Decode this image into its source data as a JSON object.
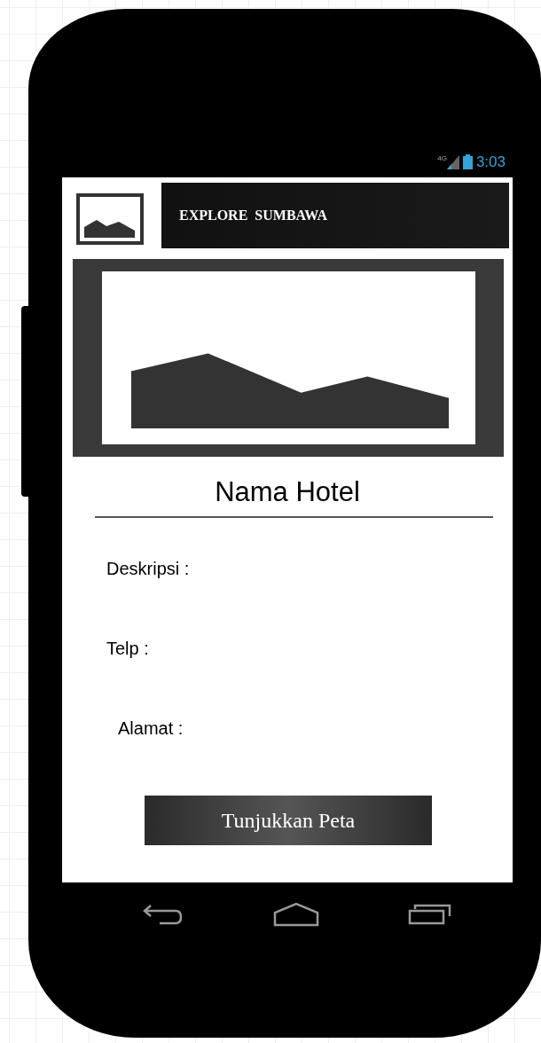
{
  "status_bar": {
    "network": "4G",
    "time": "3:03"
  },
  "header": {
    "title": "EXPLORE  SUMBAWA"
  },
  "hotel_name": "Nama Hotel",
  "fields": [
    {
      "label": "Deskripsi :"
    },
    {
      "label": "Telp :"
    },
    {
      "label": "Alamat :"
    }
  ],
  "button": {
    "label": "Tunjukkan Peta"
  }
}
